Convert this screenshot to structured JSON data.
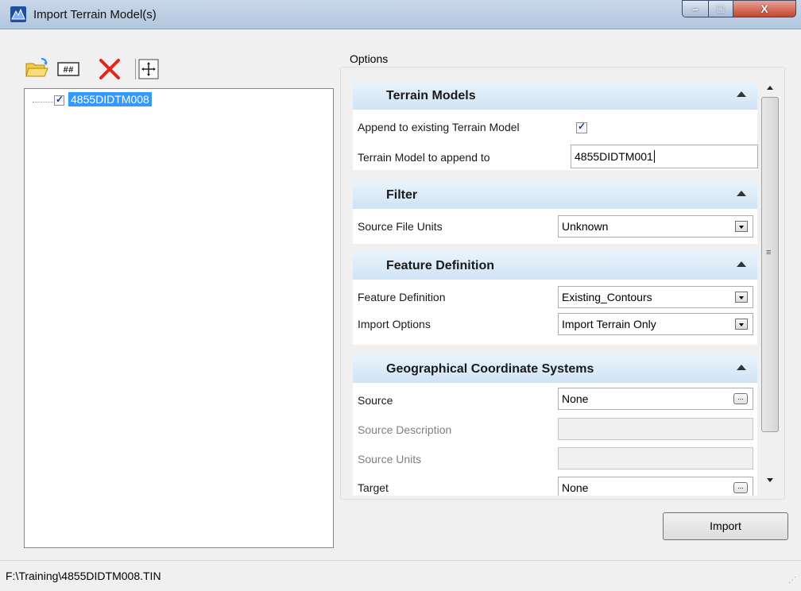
{
  "window": {
    "title": "Import Terrain Model(s)",
    "controls": {
      "minimize": "–",
      "maximize": "□",
      "close": "X"
    }
  },
  "toolbar": {
    "icons": [
      "open-folder-icon",
      "grid-icon",
      "delete-x-icon",
      "fit-extents-icon"
    ]
  },
  "tree": {
    "items": [
      {
        "label": "4855DIDTM008",
        "checked": true,
        "selected": true
      }
    ]
  },
  "options": {
    "legend": "Options",
    "sections": {
      "terrain_models": {
        "title": "Terrain Models",
        "append_label": "Append to existing Terrain Model",
        "append_checked": true,
        "append_to_label": "Terrain Model to append to",
        "append_to_value": "4855DIDTM001"
      },
      "filter": {
        "title": "Filter",
        "units_label": "Source File Units",
        "units_value": "Unknown"
      },
      "feature_definition": {
        "title": "Feature Definition",
        "fd_label": "Feature Definition",
        "fd_value": "Existing_Contours",
        "import_options_label": "Import Options",
        "import_options_value": "Import Terrain Only"
      },
      "gcs": {
        "title": "Geographical Coordinate Systems",
        "source_label": "Source",
        "source_value": "None",
        "source_desc_label": "Source Description",
        "source_desc_value": "",
        "source_units_label": "Source Units",
        "source_units_value": "",
        "target_label": "Target",
        "target_value": "None",
        "browse_label": "..."
      }
    }
  },
  "buttons": {
    "import": "Import"
  },
  "status": {
    "path": "F:\\Training\\4855DIDTM008.TIN"
  }
}
